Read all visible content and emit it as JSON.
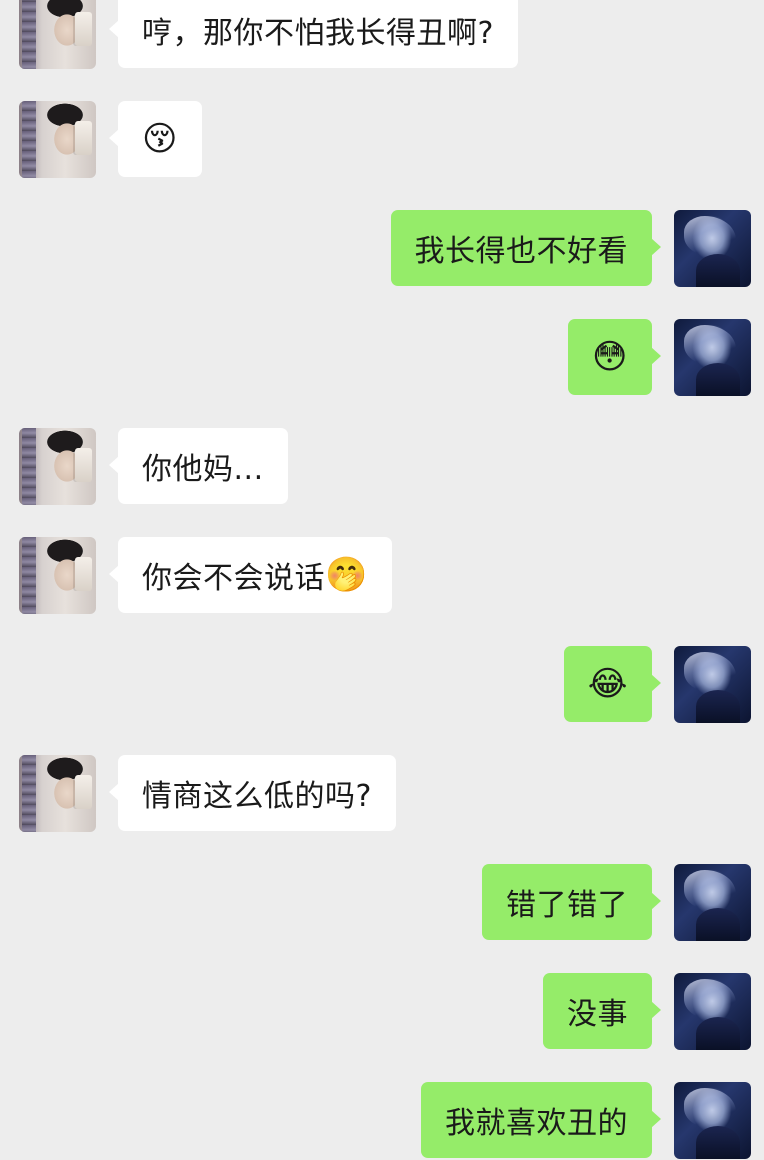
{
  "messages": [
    {
      "side": "left",
      "text": "哼，那你不怕我长得丑啊?",
      "emoji": ""
    },
    {
      "side": "left",
      "text": "",
      "emoji": "😚"
    },
    {
      "side": "right",
      "text": "我长得也不好看",
      "emoji": ""
    },
    {
      "side": "right",
      "text": "",
      "emoji": "😳"
    },
    {
      "side": "left",
      "text": "你他妈...",
      "emoji": ""
    },
    {
      "side": "left",
      "text": "你会不会说话",
      "emoji": "🤭"
    },
    {
      "side": "right",
      "text": "",
      "emoji": "😂"
    },
    {
      "side": "left",
      "text": "情商这么低的吗?",
      "emoji": ""
    },
    {
      "side": "right",
      "text": "错了错了",
      "emoji": ""
    },
    {
      "side": "right",
      "text": "没事",
      "emoji": ""
    },
    {
      "side": "right",
      "text": "我就喜欢丑的",
      "emoji": ""
    }
  ],
  "colors": {
    "background": "#ededed",
    "incoming_bubble": "#ffffff",
    "outgoing_bubble": "#95ec69",
    "text": "#1a1a1a"
  },
  "icons": {
    "incoming_avatar": "girl-selfie-avatar",
    "outgoing_avatar": "anime-character-avatar"
  }
}
